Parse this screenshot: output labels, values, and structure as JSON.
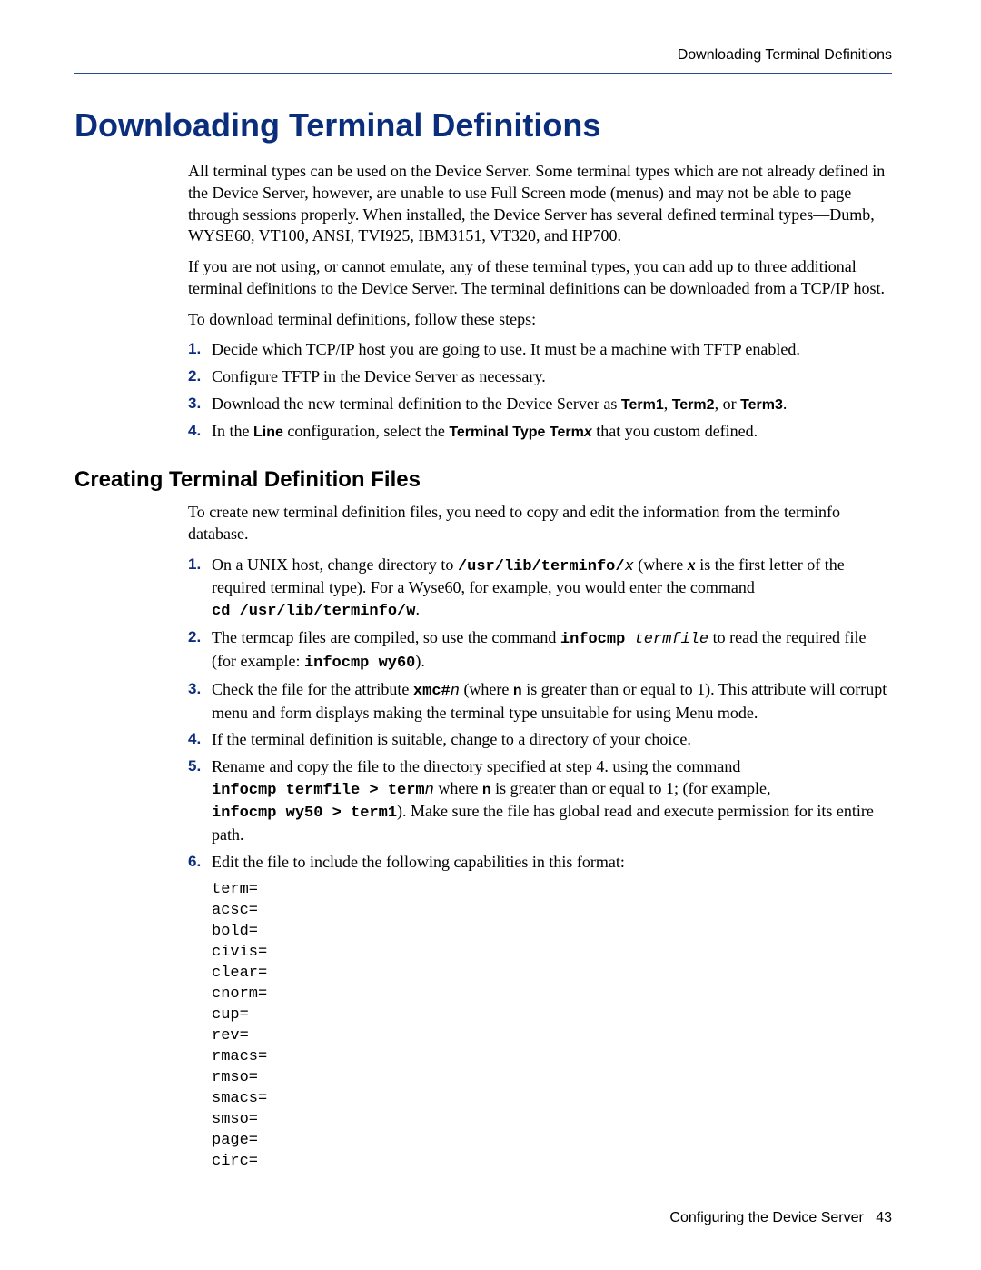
{
  "header": {
    "right": "Downloading Terminal Definitions"
  },
  "title": "Downloading Terminal Definitions",
  "intro": {
    "p1": "All terminal types can be used on the Device Server. Some terminal types which are not already defined in the Device Server, however, are unable to use Full Screen mode (menus) and may not be able to page through sessions properly. When installed, the Device Server has several defined terminal types—Dumb, WYSE60, VT100, ANSI, TVI925, IBM3151, VT320, and HP700.",
    "p2": "If you are not using, or cannot emulate, any of these terminal types, you can add up to three additional terminal definitions to the Device Server. The terminal definitions can be downloaded from a TCP/IP host.",
    "p3": "To download terminal definitions, follow these steps:"
  },
  "steps1": {
    "s1": "Decide which TCP/IP host you are going to use. It must be a machine with TFTP enabled.",
    "s2": "Configure TFTP in the Device Server as necessary.",
    "s3_a": "Download the new terminal definition to the Device Server as ",
    "s3_t1": "Term1",
    "s3_c1": ", ",
    "s3_t2": "Term2",
    "s3_c2": ", or ",
    "s3_t3": "Term3",
    "s3_end": ".",
    "s4_a": "In the ",
    "s4_line": "Line",
    "s4_b": " configuration, select the ",
    "s4_tt": "Terminal Type Term",
    "s4_x": "x",
    "s4_c": " that you custom defined."
  },
  "subhead": "Creating Terminal Definition Files",
  "create": {
    "p1": "To create new terminal definition files, you need to copy and edit the information from the terminfo database."
  },
  "steps2": {
    "s1_a": "On a UNIX host, change directory to ",
    "s1_path": "/usr/lib/terminfo/",
    "s1_x": "x",
    "s1_b": " (where ",
    "s1_x2": "x",
    "s1_c": " is the first letter of the required terminal type). For a Wyse60, for example, you would enter the command ",
    "s1_cmd": "cd /usr/lib/terminfo/w",
    "s1_end": ".",
    "s2_a": "The termcap files are compiled, so use the command ",
    "s2_cmd1": "infocmp ",
    "s2_tf": "termfile",
    "s2_b": " to read the required file (for example: ",
    "s2_cmd2": "infocmp wy60",
    "s2_end": ").",
    "s3_a": "Check the file for the attribute ",
    "s3_attr": "xmc#",
    "s3_n": "n",
    "s3_b": " (where ",
    "s3_n2": "n",
    "s3_c": " is greater than or equal to 1). This attribute will corrupt menu and form displays making the terminal type unsuitable for using Menu mode.",
    "s4": "If the terminal definition is suitable, change to a directory of your choice.",
    "s5_a": "Rename and copy the file to the directory specified at step 4. using the command ",
    "s5_cmd1": "infocmp termfile > term",
    "s5_n": "n",
    "s5_b": " where ",
    "s5_n2": "n",
    "s5_c": " is greater than or equal to 1; (for example, ",
    "s5_cmd2": "infocmp wy50 > term1",
    "s5_d": "). Make sure the file has global read and execute permission for its entire path.",
    "s6": "Edit the file to include the following capabilities in this format:"
  },
  "capabilities": "term=\nacsc=\nbold=\ncivis=\nclear=\ncnorm=\ncup=\nrev=\nrmacs=\nrmso=\nsmacs=\nsmso=\npage=\ncirc=",
  "footer": {
    "text": "Configuring the Device Server",
    "pagenum": "43"
  },
  "nums": {
    "n1": "1.",
    "n2": "2.",
    "n3": "3.",
    "n4": "4.",
    "n5": "5.",
    "n6": "6."
  }
}
